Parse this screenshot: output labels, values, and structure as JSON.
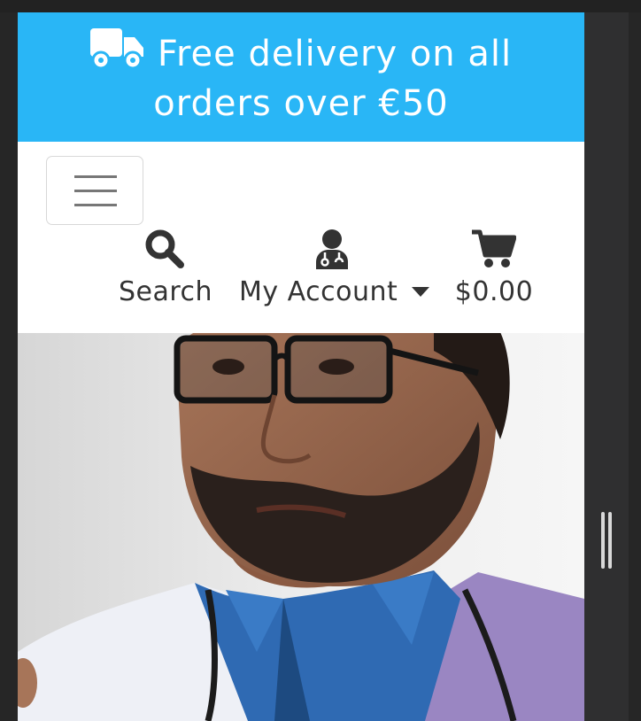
{
  "promo": {
    "line1": "Free delivery on all",
    "line2": "orders over €50",
    "icon": "truck-icon",
    "color": "#29b6f6"
  },
  "nav": {
    "menu_icon": "hamburger-icon",
    "search": {
      "label": "Search",
      "icon": "search-icon"
    },
    "account": {
      "label": "My Account",
      "icon": "user-doctor-icon",
      "dropdown_icon": "caret-down-icon"
    },
    "cart": {
      "label": "$0.00",
      "icon": "shopping-cart-icon"
    }
  },
  "hero": {
    "image": "doctor-portrait-photo"
  }
}
